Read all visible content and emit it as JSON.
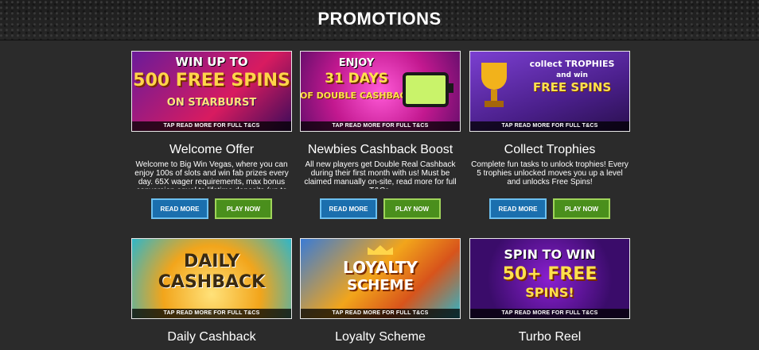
{
  "header": {
    "title": "PROMOTIONS"
  },
  "buttons": {
    "read_more": "READ MORE",
    "play_now": "PLAY NOW"
  },
  "banner_strip": "TAP READ MORE FOR FULL T&CS",
  "promotions": [
    {
      "title": "Welcome Offer",
      "description": "Welcome to Big Win Vegas, where you can enjoy 100s of slots and win fab prizes every day. 65X wager requirements, max bonus conversion equal to lifetime deposits (up to",
      "banner_line1": "WIN UP TO",
      "banner_line2": "500 FREE SPINS",
      "banner_line3": "ON STARBURST"
    },
    {
      "title": "Newbies Cashback Boost",
      "description": "All new players get Double Real Cashback during their first month with us! Must be claimed manually on-site, read more for full T&Cs.",
      "banner_line1": "ENJOY",
      "banner_line2": "31 DAYS",
      "banner_line3": "OF DOUBLE CASHBACK"
    },
    {
      "title": "Collect Trophies",
      "description": "Complete fun tasks to unlock trophies! Every 5 trophies unlocked moves you up a level and unlocks Free Spins!",
      "banner_line1": "collect TROPHIES",
      "banner_line2": "and win",
      "banner_line3": "FREE SPINS"
    },
    {
      "title": "Daily Cashback",
      "description": "",
      "banner_line1": "DAILY",
      "banner_line2": "CASHBACK",
      "banner_line3": ""
    },
    {
      "title": "Loyalty Scheme",
      "description": "",
      "banner_line1": "LOYALTY",
      "banner_line2": "SCHEME",
      "banner_line3": ""
    },
    {
      "title": "Turbo Reel",
      "description": "",
      "banner_line1": "SPIN TO WIN",
      "banner_line2": "50+ FREE",
      "banner_line3": "SPINS!"
    }
  ]
}
